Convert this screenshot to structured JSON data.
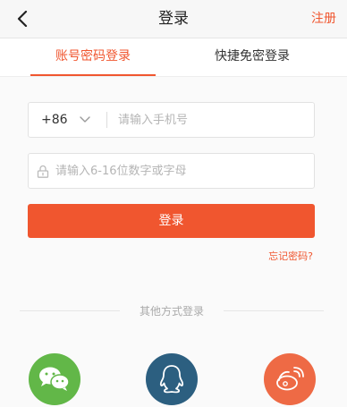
{
  "header": {
    "title": "登录",
    "register_label": "注册"
  },
  "tabs": [
    {
      "label": "账号密码登录",
      "active": true
    },
    {
      "label": "快捷免密登录",
      "active": false
    }
  ],
  "form": {
    "country_code": "+86",
    "phone_placeholder": "请输入手机号",
    "password_placeholder": "请输入6-16位数字或字母",
    "login_label": "登录",
    "forgot_label": "忘记密码?"
  },
  "other": {
    "label": "其他方式登录",
    "methods": [
      "wechat-icon",
      "qq-icon",
      "weibo-icon"
    ]
  },
  "colors": {
    "accent": "#f0562f",
    "wechat": "#62b748",
    "qq": "#2c5f80",
    "weibo": "#ee6a45"
  }
}
